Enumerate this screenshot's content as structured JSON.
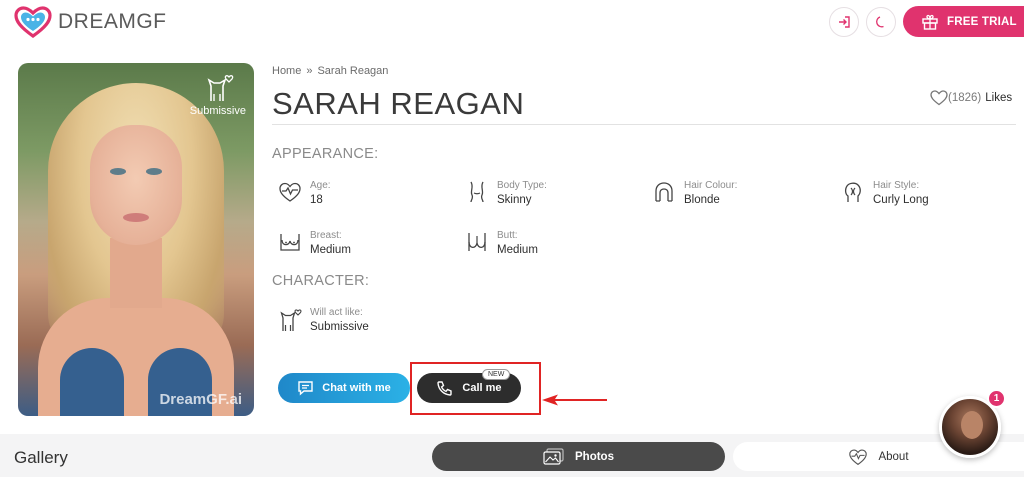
{
  "brand": {
    "name": "DREAMGF",
    "accent": "#e0336e"
  },
  "header": {
    "login_icon": "login-arrow-icon",
    "theme_icon": "moon-icon",
    "free_trial_label": "FREE TRIAL",
    "free_trial_icon": "gift-icon"
  },
  "profile": {
    "photo_badge_label": "Submissive",
    "photo_watermark": "DreamGF.ai",
    "breadcrumb": {
      "home": "Home",
      "separator": "»",
      "current": "Sarah Reagan"
    },
    "name": "SARAH REAGAN",
    "likes_count": "(1826)",
    "likes_label": "Likes"
  },
  "appearance": {
    "heading": "APPEARANCE:",
    "items": [
      {
        "label": "Age:",
        "value": "18",
        "icon": "heart-pulse-icon"
      },
      {
        "label": "Body Type:",
        "value": "Skinny",
        "icon": "body-type-icon"
      },
      {
        "label": "Hair Colour:",
        "value": "Blonde",
        "icon": "hair-colour-icon"
      },
      {
        "label": "Hair Style:",
        "value": "Curly Long",
        "icon": "hair-style-icon"
      },
      {
        "label": "Breast:",
        "value": "Medium",
        "icon": "breast-icon"
      },
      {
        "label": "Butt:",
        "value": "Medium",
        "icon": "butt-icon"
      }
    ]
  },
  "character": {
    "heading": "CHARACTER:",
    "items": [
      {
        "label": "Will act like:",
        "value": "Submissive",
        "icon": "cat-heart-icon"
      }
    ]
  },
  "actions": {
    "chat_label": "Chat with me",
    "call_label": "Call me",
    "call_badge": "NEW"
  },
  "bottom": {
    "gallery_title": "Gallery",
    "tabs": [
      {
        "label": "Photos",
        "active": true,
        "icon": "photos-icon"
      },
      {
        "label": "About",
        "active": false,
        "icon": "heart-pulse-icon"
      }
    ]
  },
  "chat_widget": {
    "unread_count": "1"
  }
}
